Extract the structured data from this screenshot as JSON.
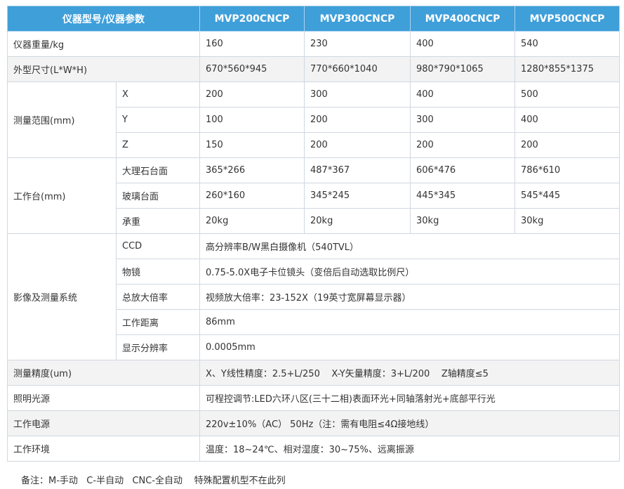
{
  "header": {
    "param": "仪器型号/仪器参数",
    "models": [
      "MVP200CNCP",
      "MVP300CNCP",
      "MVP400CNCP",
      "MVP500CNCP"
    ]
  },
  "rows": {
    "weight": {
      "label": "仪器重量/kg",
      "values": [
        "160",
        "230",
        "400",
        "540"
      ]
    },
    "size": {
      "label": "外型尺寸(L*W*H)",
      "values": [
        "670*560*945",
        "770*660*1040",
        "980*790*1065",
        "1280*855*1375"
      ]
    },
    "range": {
      "label": "测量范围(mm)",
      "x": {
        "label": "X",
        "values": [
          "200",
          "300",
          "400",
          "500"
        ]
      },
      "y": {
        "label": "Y",
        "values": [
          "100",
          "200",
          "300",
          "400"
        ]
      },
      "z": {
        "label": "Z",
        "values": [
          "150",
          "200",
          "200",
          "200"
        ]
      }
    },
    "stage": {
      "label": "工作台(mm)",
      "marble": {
        "label": "大理石台面",
        "values": [
          "365*266",
          "487*367",
          "606*476",
          "786*610"
        ]
      },
      "glass": {
        "label": "玻璃台面",
        "values": [
          "260*160",
          "345*245",
          "445*345",
          "545*445"
        ]
      },
      "load": {
        "label": "承重",
        "values": [
          "20kg",
          "20kg",
          "30kg",
          "30kg"
        ]
      }
    },
    "imaging": {
      "label": "影像及测量系统",
      "ccd": {
        "label": "CCD",
        "value": "高分辨率B/W黑白摄像机（540TVL）"
      },
      "lens": {
        "label": "物镜",
        "value": "0.75-5.0X电子卡位镜头（变倍后自动选取比例尺）"
      },
      "mag": {
        "label": "总放大倍率",
        "value": "视频放大倍率：23-152X（19英寸宽屏幕显示器）"
      },
      "wd": {
        "label": "工作距离",
        "value": "86mm"
      },
      "res": {
        "label": "显示分辨率",
        "value": "0.0005mm"
      }
    },
    "accuracy": {
      "label": "测量精度(um)",
      "value": "X、Y线性精度：2.5+L/250    X-Y矢量精度：3+L/200    Z轴精度≤5"
    },
    "light": {
      "label": "照明光源",
      "value": "可程控调节:LED六环八区(三十二相)表面环光+同轴落射光+底部平行光"
    },
    "power": {
      "label": "工作电源",
      "value": "220v±10%（AC） 50Hz（注：需有电阻≤4Ω接地线）"
    },
    "env": {
      "label": "工作环境",
      "value": "温度：18~24℃、相对湿度：30~75%、远离振源"
    }
  },
  "note": "备注：M-手动   C-半自动   CNC-全自动    特殊配置机型不在此列",
  "colors": {
    "header_bg": "#3f9fd9",
    "border": "#cfd8e0",
    "alt_row": "#f3f3f3"
  }
}
